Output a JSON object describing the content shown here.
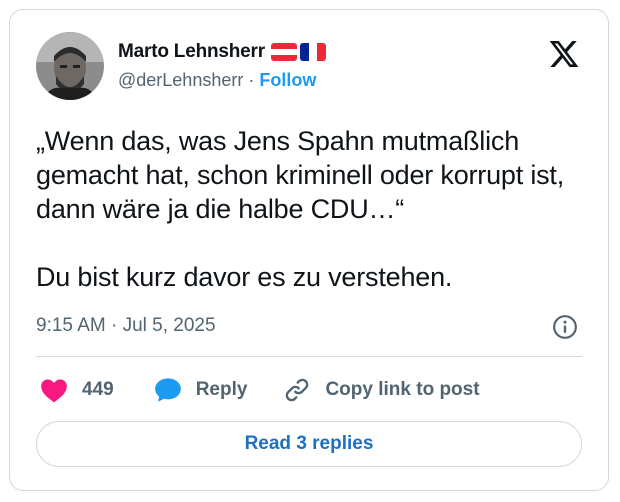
{
  "author": {
    "name": "Marto Lehnsherr",
    "handle": "@derLehnsherr",
    "separator": "·",
    "follow_label": "Follow",
    "flags": [
      "austria-flag",
      "france-flag"
    ]
  },
  "tweet": {
    "text": "„Wenn das, was Jens Spahn mutmaßlich gemacht hat, schon kriminell oder korrupt ist, dann wäre ja die halbe CDU…“\n\nDu bist kurz davor es zu verstehen.",
    "timestamp": "9:15 AM · Jul 5, 2025"
  },
  "actions": {
    "likes_count": "449",
    "reply_label": "Reply",
    "copy_link_label": "Copy link to post"
  },
  "footer": {
    "read_replies_label": "Read 3 replies"
  },
  "colors": {
    "like_pink": "#f91880",
    "reply_blue": "#1d9bf0",
    "link_blue": "#1d70c2",
    "muted_text": "#536471",
    "border": "#cfd9de"
  },
  "icons": {
    "brand": "x-logo-icon",
    "info": "info-icon",
    "like": "heart-icon",
    "reply": "speech-bubble-icon",
    "copy": "link-icon"
  }
}
